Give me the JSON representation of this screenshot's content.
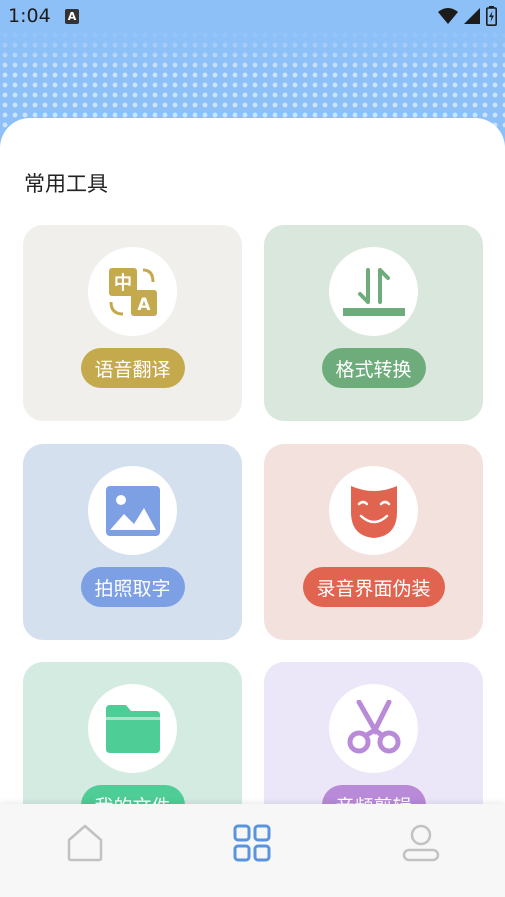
{
  "status_bar": {
    "time": "1:04",
    "notification_icon": "A"
  },
  "section": {
    "title": "常用工具"
  },
  "tools": [
    {
      "label": "语音翻译",
      "icon": "translate-icon",
      "card_color": "#f0efeb",
      "accent": "#c4aa4c"
    },
    {
      "label": "格式转换",
      "icon": "format-convert-icon",
      "card_color": "#d9e7dd",
      "accent": "#6ead7b"
    },
    {
      "label": "拍照取字",
      "icon": "image-icon",
      "card_color": "#d5e0ef",
      "accent": "#7d9fe3"
    },
    {
      "label": "录音界面伪装",
      "icon": "mask-icon",
      "card_color": "#f2e1dc",
      "accent": "#e0644f"
    },
    {
      "label": "我的文件",
      "icon": "folder-icon",
      "card_color": "#d4ebe2",
      "accent": "#4fcd97"
    },
    {
      "label": "音频剪辑",
      "icon": "scissors-icon",
      "card_color": "#ebe7f8",
      "accent": "#b98ad8"
    }
  ],
  "bottom_nav": {
    "items": [
      "home-icon",
      "grid-icon",
      "user-icon"
    ],
    "active": "grid-icon"
  }
}
